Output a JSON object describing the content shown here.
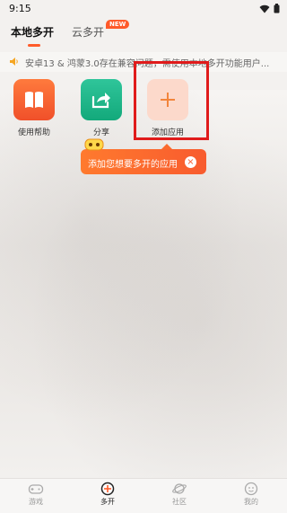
{
  "status_bar": {
    "time": "9:15"
  },
  "tabs": {
    "local_label": "本地多开",
    "cloud_label": "云多开",
    "new_badge": "NEW"
  },
  "notice": {
    "icon": "speaker-icon",
    "text": "安卓13 & 鸿蒙3.0存在兼容问题，需使用本地多开功能用户..."
  },
  "apps": {
    "help": {
      "label": "使用帮助",
      "icon": "book-icon"
    },
    "share": {
      "label": "分享",
      "icon": "share-icon"
    },
    "add": {
      "label": "添加应用",
      "icon": "plus-icon"
    }
  },
  "tooltip": {
    "text": "添加您想要多开的应用",
    "close_glyph": "×"
  },
  "bottom_nav": {
    "games": "游戏",
    "multi": "多开",
    "community": "社区",
    "mine": "我的"
  },
  "colors": {
    "accent": "#ff5b2a",
    "highlight_border": "#e01b1b",
    "help_icon": "#f0502a",
    "share_icon": "#13a97b",
    "add_icon_bg": "#fcd9cb"
  }
}
